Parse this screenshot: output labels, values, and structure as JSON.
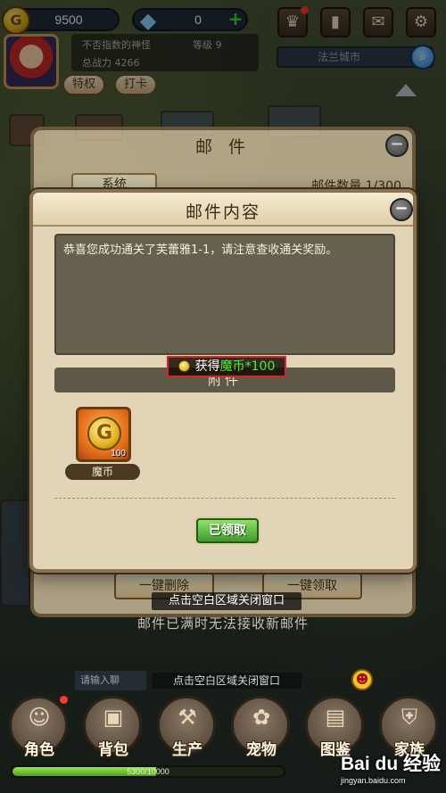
{
  "hud": {
    "gold": "9500",
    "gems": "0",
    "player_name": "不否指数的神怪",
    "level_label": "等级 9",
    "power_label": "总战力 4266",
    "privilege_label": "特权",
    "checkin_label": "打卡",
    "server_name": "法兰城市"
  },
  "mail_panel": {
    "title": "邮 件",
    "tab_system": "系统",
    "count": "邮件数量 1/300",
    "delete_all_label": "一键删除",
    "claim_all_label": "一键领取"
  },
  "dialog": {
    "title": "邮件内容",
    "message": "恭喜您成功通关了芙蕾雅1-1，请注意查收通关奖励。",
    "attachment_header": "附件",
    "gain_prefix": "获得",
    "gain_item": "魔币*100",
    "item_qty": "100",
    "item_name": "魔币",
    "claimed_label": "已领取"
  },
  "footer": {
    "close_hint": "点击空白区域关闭窗口",
    "full_notice": "邮件已满时无法接收新邮件",
    "chat_placeholder": "请输入聊",
    "close_hint_2": "点击空白区域关闭窗口"
  },
  "nav": [
    {
      "label": "角色",
      "icon": "character-icon"
    },
    {
      "label": "背包",
      "icon": "backpack-icon"
    },
    {
      "label": "生产",
      "icon": "production-icon"
    },
    {
      "label": "宠物",
      "icon": "pet-icon"
    },
    {
      "label": "图鉴",
      "icon": "handbook-icon"
    },
    {
      "label": "家族",
      "icon": "family-icon"
    }
  ],
  "xp": {
    "text": "5300/10000",
    "fraction": 0.53
  },
  "watermark": {
    "main": "Bai du 经验",
    "sub": "jingyan.baidu.com"
  },
  "colors": {
    "accent_red": "#e0202a",
    "claimed_green": "#3f9a2a",
    "gain_green": "#4eea3c"
  }
}
